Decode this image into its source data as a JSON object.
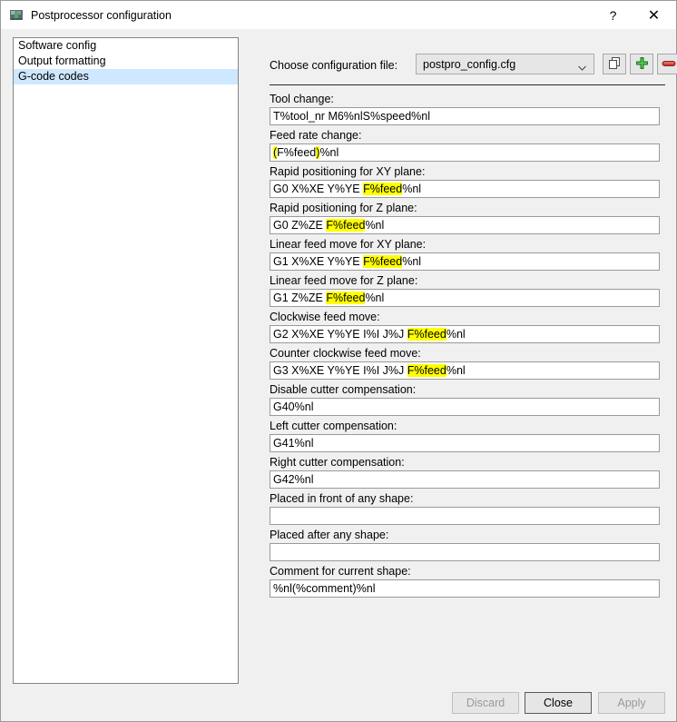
{
  "window": {
    "title": "Postprocessor configuration",
    "icon": "app-icon",
    "help_label": "?",
    "close_label": "✕"
  },
  "sidebar": {
    "items": [
      {
        "label": "Software config",
        "selected": false
      },
      {
        "label": "Output formatting",
        "selected": false
      },
      {
        "label": "G-code codes",
        "selected": true
      }
    ]
  },
  "config": {
    "label": "Choose configuration file:",
    "selected_file": "postpro_config.cfg",
    "copy_button_title": "duplicate-configuration",
    "add_button_title": "add-configuration",
    "delete_button_title": "remove-configuration"
  },
  "fields": [
    {
      "label": "Tool change:",
      "segments": [
        {
          "text": "T%tool_nr M6%nlS%speed%nl",
          "hl": false
        }
      ]
    },
    {
      "label": "Feed rate change:",
      "segments": [
        {
          "text": "(",
          "hl": true
        },
        {
          "text": "F%feed",
          "hl": false
        },
        {
          "text": ")",
          "hl": true
        },
        {
          "text": "%nl",
          "hl": false
        }
      ]
    },
    {
      "label": "Rapid positioning for XY plane:",
      "segments": [
        {
          "text": "G0 X%XE Y%YE ",
          "hl": false
        },
        {
          "text": "F%feed",
          "hl": true
        },
        {
          "text": "%nl",
          "hl": false
        }
      ]
    },
    {
      "label": "Rapid positioning for Z plane:",
      "segments": [
        {
          "text": "G0 Z%ZE ",
          "hl": false
        },
        {
          "text": "F%feed",
          "hl": true
        },
        {
          "text": "%nl",
          "hl": false
        }
      ]
    },
    {
      "label": "Linear feed move for XY plane:",
      "segments": [
        {
          "text": "G1 X%XE Y%YE ",
          "hl": false
        },
        {
          "text": "F%feed",
          "hl": true
        },
        {
          "text": "%nl",
          "hl": false
        }
      ]
    },
    {
      "label": "Linear feed move for Z plane:",
      "segments": [
        {
          "text": "G1 Z%ZE ",
          "hl": false
        },
        {
          "text": "F%feed",
          "hl": true
        },
        {
          "text": "%nl",
          "hl": false
        }
      ]
    },
    {
      "label": "Clockwise feed move:",
      "segments": [
        {
          "text": "G2 X%XE Y%YE I%I J%J ",
          "hl": false
        },
        {
          "text": "F%feed",
          "hl": true
        },
        {
          "text": "%nl",
          "hl": false
        }
      ]
    },
    {
      "label": "Counter clockwise feed move:",
      "segments": [
        {
          "text": "G3 X%XE Y%YE I%I J%J ",
          "hl": false
        },
        {
          "text": "F%feed",
          "hl": true
        },
        {
          "text": "%nl",
          "hl": false
        }
      ]
    },
    {
      "label": "Disable cutter compensation:",
      "segments": [
        {
          "text": "G40%nl",
          "hl": false
        }
      ]
    },
    {
      "label": "Left cutter compensation:",
      "segments": [
        {
          "text": "G41%nl",
          "hl": false
        }
      ]
    },
    {
      "label": "Right cutter compensation:",
      "segments": [
        {
          "text": "G42%nl",
          "hl": false
        }
      ]
    },
    {
      "label": "Placed in front of any shape:",
      "segments": [
        {
          "text": "",
          "hl": false
        }
      ]
    },
    {
      "label": "Placed after any shape:",
      "segments": [
        {
          "text": "",
          "hl": false
        }
      ]
    },
    {
      "label": "Comment for current shape:",
      "segments": [
        {
          "text": "%nl(%comment)%nl",
          "hl": false
        }
      ]
    }
  ],
  "footer": {
    "discard_label": "Discard",
    "discard_enabled": false,
    "close_label": "Close",
    "close_enabled": true,
    "apply_label": "Apply",
    "apply_enabled": false
  },
  "colors": {
    "window_bg": "#f0f0f0",
    "titlebar_bg": "#ffffff",
    "selection": "#cde8ff",
    "highlight": "#ffff00",
    "input_bg": "#ffffff",
    "border": "#848484",
    "add_green": "#2ca02c",
    "delete_red": "#c0392b"
  }
}
